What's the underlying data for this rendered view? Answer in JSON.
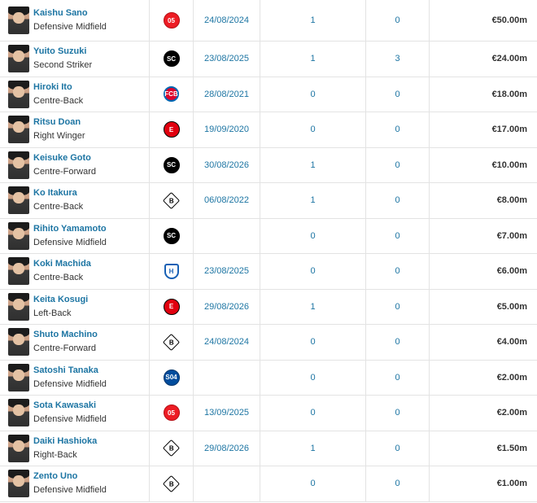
{
  "players": [
    {
      "name": "Kaishu Sano",
      "position": "Defensive Midfield",
      "club_icon": "mainz-crest",
      "club_abbr": "05",
      "date": "24/08/2024",
      "col_a": "1",
      "col_b": "0",
      "value": "€50.00m"
    },
    {
      "name": "Yuito Suzuki",
      "position": "Second Striker",
      "club_icon": "freiburg-crest",
      "club_abbr": "SC",
      "date": "23/08/2025",
      "col_a": "1",
      "col_b": "3",
      "value": "€24.00m"
    },
    {
      "name": "Hiroki Ito",
      "position": "Centre-Back",
      "club_icon": "bayern-crest",
      "club_abbr": "FCB",
      "date": "28/08/2021",
      "col_a": "0",
      "col_b": "0",
      "value": "€18.00m"
    },
    {
      "name": "Ritsu Doan",
      "position": "Right Winger",
      "club_icon": "frankfurt-crest",
      "club_abbr": "E",
      "date": "19/09/2020",
      "col_a": "0",
      "col_b": "0",
      "value": "€17.00m"
    },
    {
      "name": "Keisuke Goto",
      "position": "Centre-Forward",
      "club_icon": "freiburg-crest",
      "club_abbr": "SC",
      "date": "30/08/2026",
      "col_a": "1",
      "col_b": "0",
      "value": "€10.00m"
    },
    {
      "name": "Ko Itakura",
      "position": "Centre-Back",
      "club_icon": "gladbach-crest",
      "club_abbr": "B",
      "date": "06/08/2022",
      "col_a": "1",
      "col_b": "0",
      "value": "€8.00m"
    },
    {
      "name": "Rihito Yamamoto",
      "position": "Defensive Midfield",
      "club_icon": "freiburg-crest",
      "club_abbr": "SC",
      "date": "",
      "col_a": "0",
      "col_b": "0",
      "value": "€7.00m"
    },
    {
      "name": "Koki Machida",
      "position": "Centre-Back",
      "club_icon": "hoffenheim-crest",
      "club_abbr": "H",
      "date": "23/08/2025",
      "col_a": "0",
      "col_b": "0",
      "value": "€6.00m"
    },
    {
      "name": "Keita Kosugi",
      "position": "Left-Back",
      "club_icon": "frankfurt-crest",
      "club_abbr": "E",
      "date": "29/08/2026",
      "col_a": "1",
      "col_b": "0",
      "value": "€5.00m"
    },
    {
      "name": "Shuto Machino",
      "position": "Centre-Forward",
      "club_icon": "gladbach-crest",
      "club_abbr": "B",
      "date": "24/08/2024",
      "col_a": "0",
      "col_b": "0",
      "value": "€4.00m"
    },
    {
      "name": "Satoshi Tanaka",
      "position": "Defensive Midfield",
      "club_icon": "schalke-crest",
      "club_abbr": "S04",
      "date": "",
      "col_a": "0",
      "col_b": "0",
      "value": "€2.00m"
    },
    {
      "name": "Sota Kawasaki",
      "position": "Defensive Midfield",
      "club_icon": "mainz-crest",
      "club_abbr": "05",
      "date": "13/09/2025",
      "col_a": "0",
      "col_b": "0",
      "value": "€2.00m"
    },
    {
      "name": "Daiki Hashioka",
      "position": "Right-Back",
      "club_icon": "gladbach-crest",
      "club_abbr": "B",
      "date": "29/08/2026",
      "col_a": "1",
      "col_b": "0",
      "value": "€1.50m"
    },
    {
      "name": "Zento Uno",
      "position": "Defensive Midfield",
      "club_icon": "gladbach-crest",
      "club_abbr": "B",
      "date": "",
      "col_a": "0",
      "col_b": "0",
      "value": "€1.00m"
    }
  ]
}
